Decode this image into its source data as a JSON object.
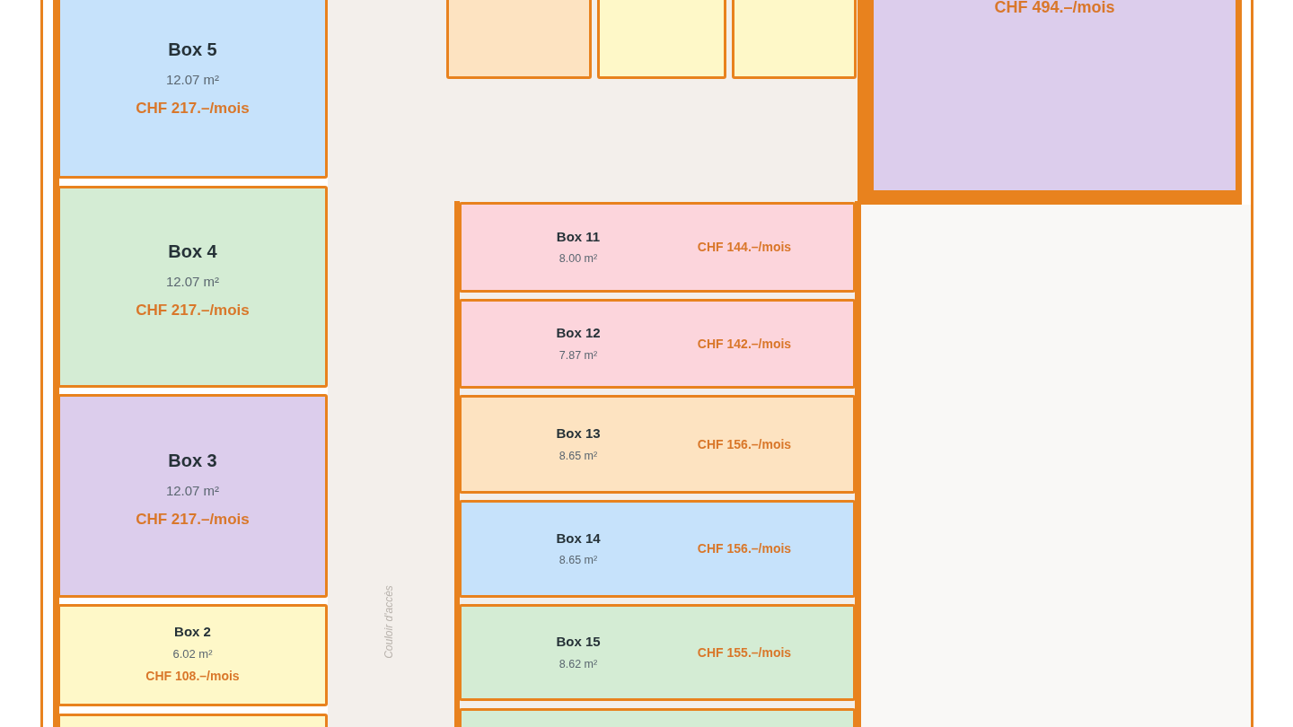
{
  "left_column": {
    "boxes": [
      {
        "name": "Box 5",
        "area": "12.07 m²",
        "price": "CHF 217.–/mois",
        "color": "#c6e2fb",
        "kind": "large"
      },
      {
        "name": "Box 4",
        "area": "12.07 m²",
        "price": "CHF 217.–/mois",
        "color": "#d4ecd4",
        "kind": "large"
      },
      {
        "name": "Box 3",
        "area": "12.07 m²",
        "price": "CHF 217.–/mois",
        "color": "#dccdec",
        "kind": "large"
      },
      {
        "name": "Box 2",
        "area": "6.02 m²",
        "price": "CHF 108.–/mois",
        "color": "#fef8c8",
        "kind": "small"
      },
      {
        "color": "#fef8c8",
        "kind": "empty"
      }
    ]
  },
  "top_row": {
    "boxes": [
      {
        "color": "#fde3c1"
      },
      {
        "color": "#fef8c8"
      },
      {
        "color": "#fef8c8"
      }
    ]
  },
  "corridor": {
    "label": "Couloir d'accès"
  },
  "large_box": {
    "price": "CHF 494.–/mois",
    "color": "#dccdec"
  },
  "middle_column": {
    "boxes": [
      {
        "name": "Box 11",
        "area": "8.00 m²",
        "price": "CHF 144.–/mois",
        "color": "#fcd5dc",
        "kind": "row"
      },
      {
        "name": "Box 12",
        "area": "7.87 m²",
        "price": "CHF 142.–/mois",
        "color": "#fcd5dc",
        "kind": "row"
      },
      {
        "name": "Box 13",
        "area": "8.65 m²",
        "price": "CHF 156.–/mois",
        "color": "#fde3c1",
        "kind": "row"
      },
      {
        "name": "Box 14",
        "area": "8.65 m²",
        "price": "CHF 156.–/mois",
        "color": "#c6e2fb",
        "kind": "row"
      },
      {
        "name": "Box 15",
        "area": "8.62 m²",
        "price": "CHF 155.–/mois",
        "color": "#d4ecd4",
        "kind": "row"
      },
      {
        "color": "#d4ecd4",
        "kind": "empty"
      }
    ]
  }
}
